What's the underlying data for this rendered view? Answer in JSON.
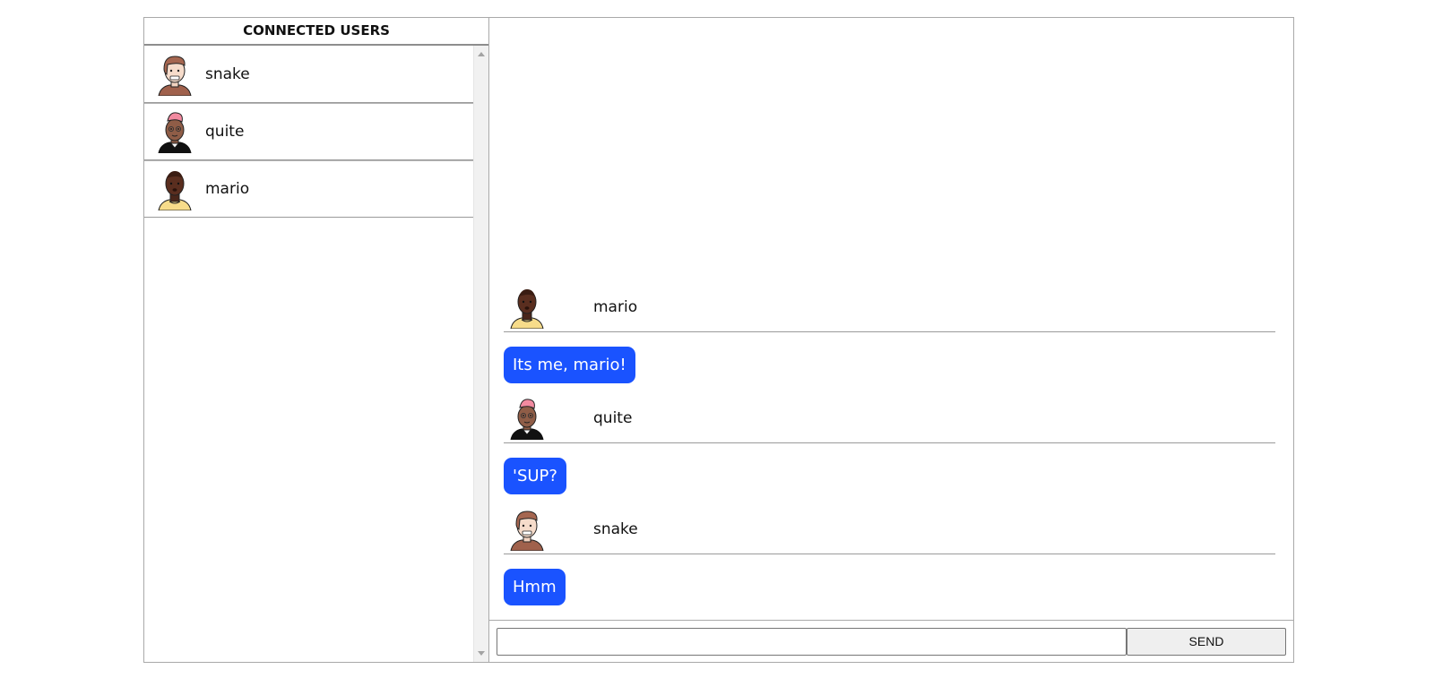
{
  "users_panel": {
    "title": "CONNECTED USERS",
    "users": [
      {
        "name": "snake",
        "avatar": "snake-avatar-icon"
      },
      {
        "name": "quite",
        "avatar": "quite-avatar-icon"
      },
      {
        "name": "mario",
        "avatar": "mario-avatar-icon"
      }
    ]
  },
  "chat": {
    "messages": [
      {
        "sender": "mario",
        "avatar": "mario-avatar-icon",
        "text": "Its me, mario!"
      },
      {
        "sender": "quite",
        "avatar": "quite-avatar-icon",
        "text": "'SUP?"
      },
      {
        "sender": "snake",
        "avatar": "snake-avatar-icon",
        "text": "Hmm"
      }
    ],
    "input": {
      "value": "",
      "placeholder": ""
    },
    "send_label": "SEND"
  },
  "colors": {
    "bubble": "#1a53ff",
    "bubble_text": "#ffffff",
    "border": "#a9a9a9"
  }
}
